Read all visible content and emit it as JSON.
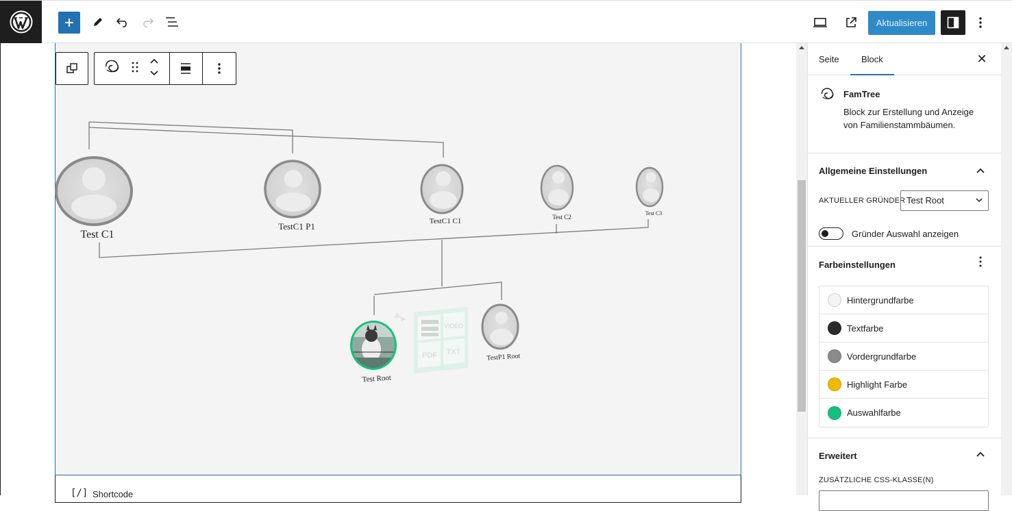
{
  "topbar": {
    "logo_icon": "wordpress-logo-icon",
    "tools": [
      "add-block-icon",
      "pencil-icon",
      "undo-icon",
      "redo-icon",
      "list-view-icon"
    ],
    "right_tools": [
      "desktop-preview-icon",
      "external-link-icon"
    ],
    "update_label": "Aktualisieren",
    "accent_color": "#2271b1"
  },
  "canvas": {
    "tree": {
      "people": [
        {
          "name": "Test C1"
        },
        {
          "name": "TestC1 P1"
        },
        {
          "name": "TestC1 C1"
        },
        {
          "name": "Test C2"
        },
        {
          "name": "Test C3"
        },
        {
          "name": "Test Root"
        },
        {
          "name": "TestP1 Root"
        }
      ],
      "media_tiles": [
        "VIDEO",
        "PDF",
        "TXT"
      ]
    },
    "shortcode_label": "Shortcode",
    "shortcode_icon": "[/]"
  },
  "sidebar": {
    "tabs": [
      {
        "label": "Seite"
      },
      {
        "label": "Block"
      }
    ],
    "active_tab": "Block",
    "block_card": {
      "title": "FamTree",
      "description": "Block zur Erstellung und Anzeige von Familienstammbäumen."
    },
    "general": {
      "title": "Allgemeine Einstellungen",
      "founder_label": "AKTUELLER GRÜNDER",
      "founder_value": "Test Root",
      "toggle_label": "Gründer Auswahl anzeigen"
    },
    "colors": {
      "title": "Farbeinstellungen",
      "items": [
        {
          "label": "Hintergrundfarbe",
          "color": "#f4f4f4"
        },
        {
          "label": "Textfarbe",
          "color": "#2b2b2b"
        },
        {
          "label": "Vordergrundfarbe",
          "color": "#8a8a8a"
        },
        {
          "label": "Highlight Farbe",
          "color": "#f1b800"
        },
        {
          "label": "Auswahlfarbe",
          "color": "#12c27e"
        }
      ]
    },
    "advanced": {
      "title": "Erweitert",
      "css_label": "ZUSÄTZLICHE CSS-KLASSE(N)"
    }
  }
}
